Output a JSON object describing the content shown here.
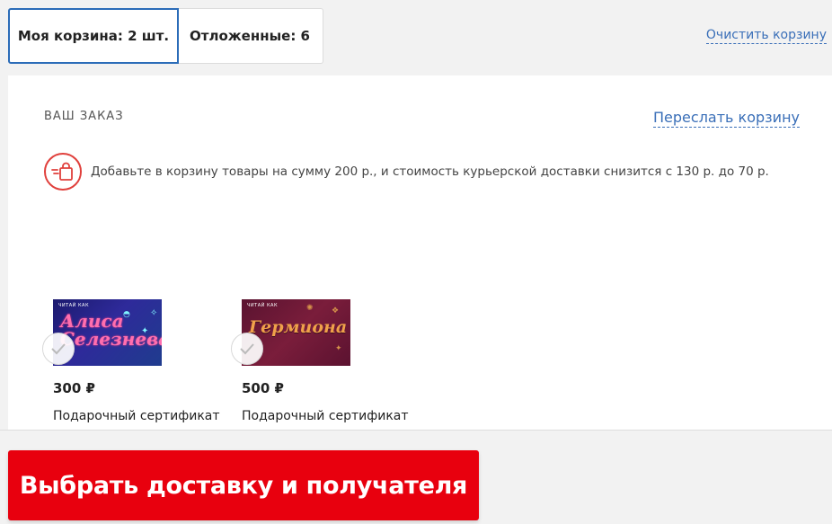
{
  "tabs": [
    {
      "label": "Моя корзина: 2 шт.",
      "active": true
    },
    {
      "label": "Отложенные: 6",
      "active": false
    }
  ],
  "clear_cart_label": "Очистить корзину",
  "order": {
    "title": "ВАШ ЗАКАЗ",
    "forward_label": "Переслать корзину",
    "notice_text": "Добавьте в корзину товары на сумму 200 р., и стоимость курьерской доставки снизится с 130 р. до 70 р.",
    "notice_icon": "delivery-bag-icon"
  },
  "products": [
    {
      "price": "300 ₽",
      "name": "Подарочный сертификат",
      "cover_brand": "ЧИТАЙ КАК",
      "cover_title": "Алиса Селезнева",
      "selected": true
    },
    {
      "price": "500 ₽",
      "name": "Подарочный сертификат",
      "cover_brand": "ЧИТАЙ КАК",
      "cover_title": "Гермиона",
      "selected": true
    }
  ],
  "checkout_button_label": "Выбрать доставку и получателя",
  "colors": {
    "accent": "#e8000e",
    "link": "#3a6fb8",
    "active_tab_border": "#2b6cb8"
  }
}
